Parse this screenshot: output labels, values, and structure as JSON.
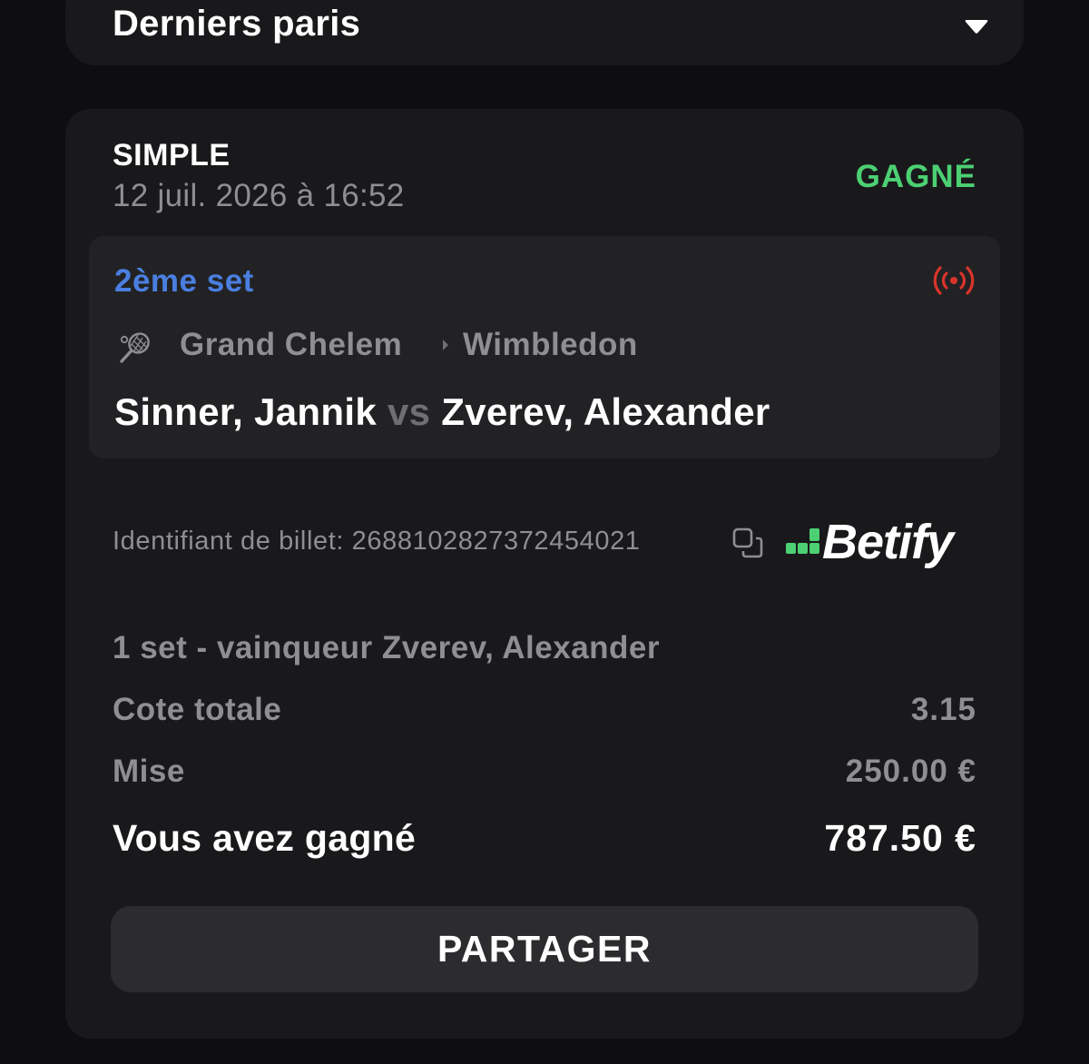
{
  "header": {
    "title": "Derniers paris",
    "toggle_icon": "caret-down-icon"
  },
  "bet": {
    "type": "SIMPLE",
    "date": "12 juil. 2026 à 16:52",
    "status": "GAGNÉ",
    "status_color": "#4cd073",
    "event": {
      "live_label": "2ème set",
      "live_label_color": "#4a7fe0",
      "live_icon": "live-broadcast-icon",
      "live_icon_color": "#d9342b",
      "sport_icon": "tennis-racket-icon",
      "competition": "Grand Chelem",
      "tournament": "Wimbledon",
      "player_1": "Sinner, Jannik",
      "vs": "vs",
      "player_2": "Zverev, Alexander"
    },
    "ticket": {
      "label": "Identifiant de billet: 26881028273724540​21",
      "copy_icon": "copy-icon"
    },
    "brand": {
      "name": "Betify",
      "logo_color": "#4cd073"
    },
    "selection": "1 set - vainqueur Zverev, Alexander",
    "odds_label": "Cote totale",
    "odds_value": "3.15",
    "stake_label": "Mise",
    "stake_value": "250.00 €",
    "win_label": "Vous avez gagné",
    "win_value": "787.50 €",
    "share_label": "PARTAGER"
  }
}
